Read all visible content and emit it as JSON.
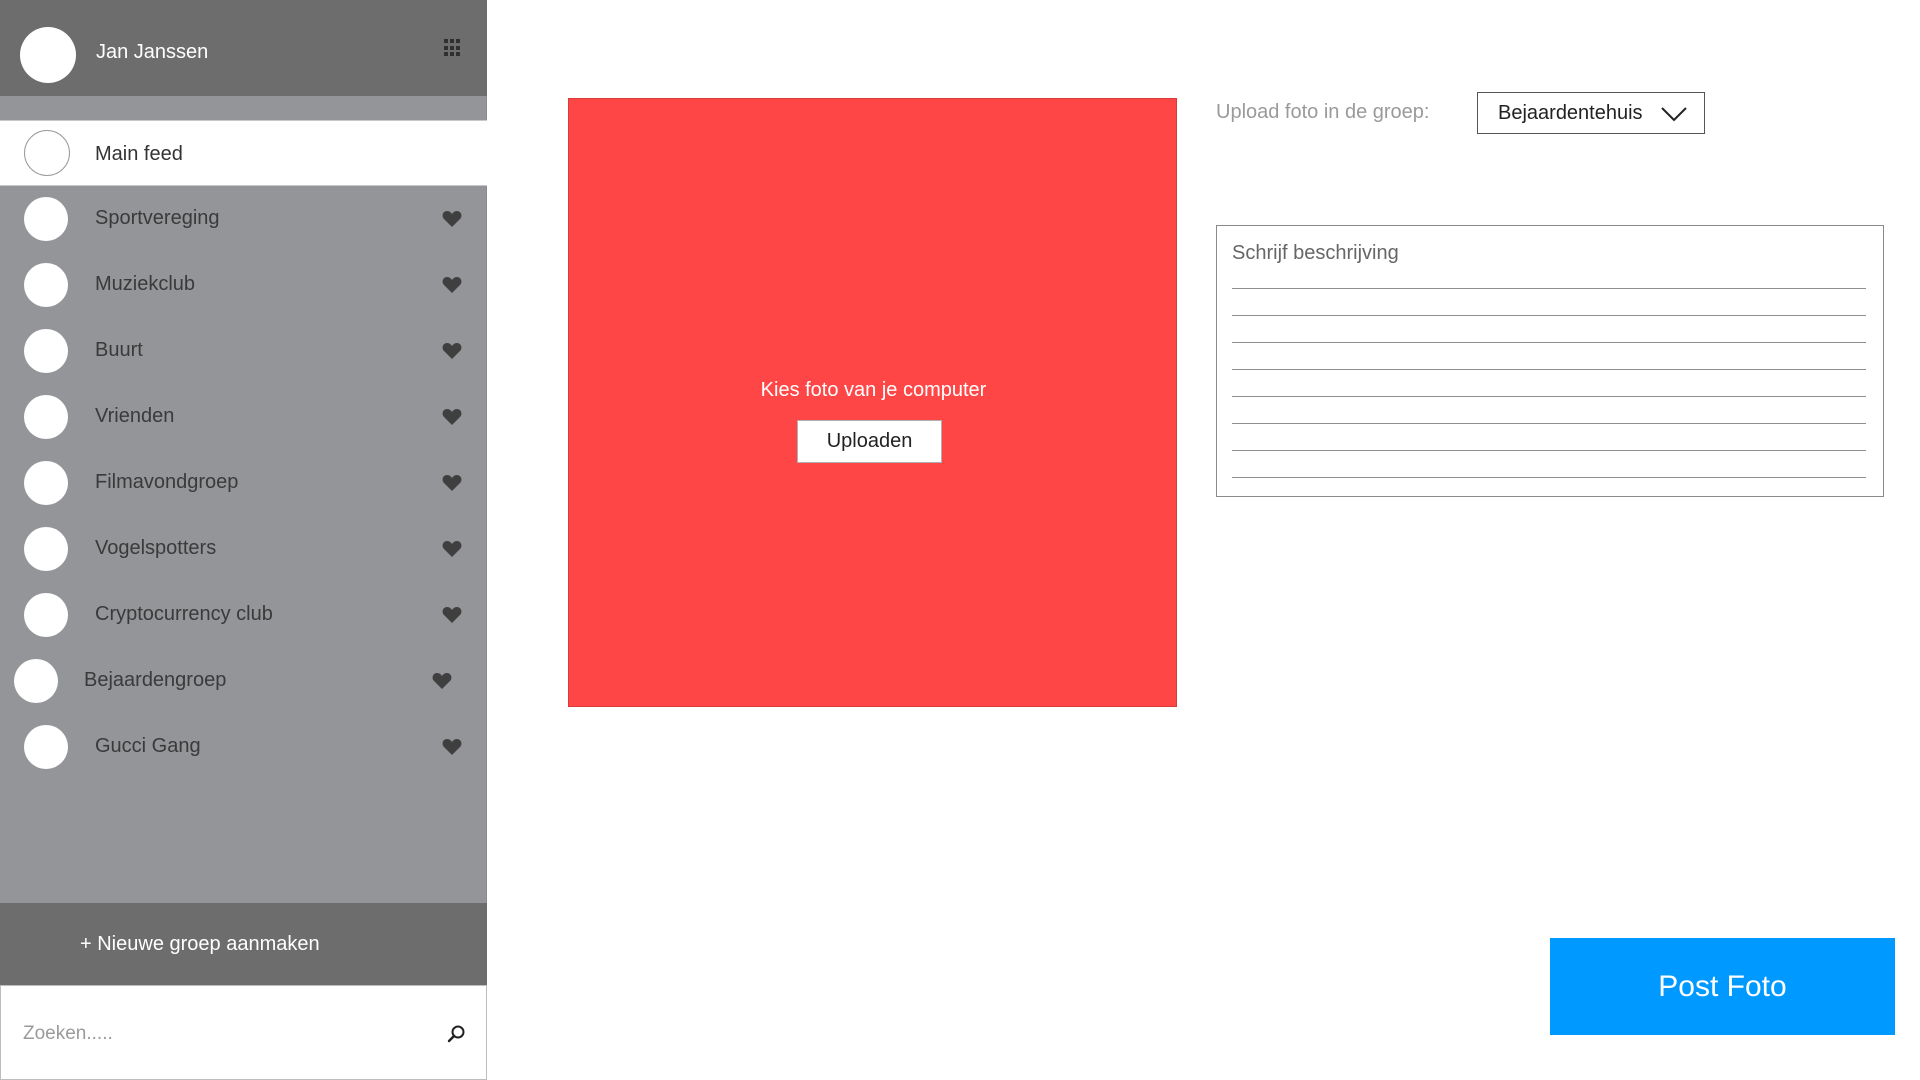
{
  "user": {
    "name": "Jan Janssen"
  },
  "sidebar": {
    "apps_icon": "grid-icon",
    "groups": [
      {
        "label": "Main feed",
        "active": true,
        "favorite": false
      },
      {
        "label": "Sportvereging",
        "active": false,
        "favorite": true
      },
      {
        "label": "Muziekclub",
        "active": false,
        "favorite": true
      },
      {
        "label": "Buurt",
        "active": false,
        "favorite": true
      },
      {
        "label": "Vrienden",
        "active": false,
        "favorite": true
      },
      {
        "label": "Filmavondgroep",
        "active": false,
        "favorite": true
      },
      {
        "label": "Vogelspotters",
        "active": false,
        "favorite": true
      },
      {
        "label": "Cryptocurrency club",
        "active": false,
        "favorite": true
      },
      {
        "label": "Bejaardengroep",
        "active": false,
        "favorite": true
      },
      {
        "label": "Gucci Gang",
        "active": false,
        "favorite": true
      }
    ],
    "new_group_label": "+ Nieuwe groep aanmaken",
    "search": {
      "placeholder": "Zoeken.....",
      "value": ""
    }
  },
  "upload": {
    "hint": "Kies foto van je computer",
    "button_label": "Uploaden",
    "zone_color": "#ff4646"
  },
  "group_select": {
    "label": "Upload foto in de groep:",
    "value": "Bejaardentehuis"
  },
  "description": {
    "placeholder": "Schrijf beschrijving",
    "line_count": 8
  },
  "post_button": {
    "label": "Post Foto",
    "color": "#0099ff"
  },
  "colors": {
    "sidebar": "#939598",
    "header": "#6d6d6d",
    "heart": "#3f3f3f"
  }
}
